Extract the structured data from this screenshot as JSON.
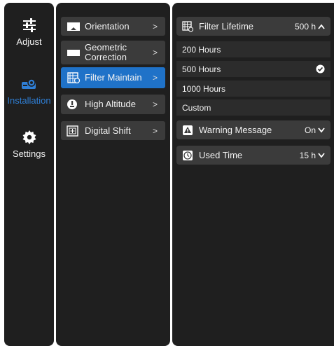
{
  "sidebar": {
    "items": [
      {
        "label": "Adjust",
        "icon": "sliders-icon"
      },
      {
        "label": "Installation",
        "icon": "projector-icon",
        "active": true
      },
      {
        "label": "Settings",
        "icon": "gear-icon"
      }
    ]
  },
  "submenu": {
    "items": [
      {
        "label": "Orientation",
        "icon": "orientation-icon"
      },
      {
        "label_line1": "Geometric",
        "label_line2": "Correction",
        "icon": "geometric-icon"
      },
      {
        "label": "Filter Maintain",
        "icon": "filter-icon",
        "active": true
      },
      {
        "label": "High Altitude",
        "icon": "altitude-icon"
      },
      {
        "label": "Digital Shift",
        "icon": "shift-icon"
      }
    ],
    "chevron": ">"
  },
  "detail": {
    "filter_lifetime": {
      "label": "Filter Lifetime",
      "value": "500 h",
      "expanded": true
    },
    "options": [
      {
        "label": "200 Hours",
        "selected": false
      },
      {
        "label": "500 Hours",
        "selected": true
      },
      {
        "label": "1000 Hours",
        "selected": false
      },
      {
        "label": "Custom",
        "selected": false
      }
    ],
    "warning_message": {
      "label": "Warning Message",
      "value": "On"
    },
    "used_time": {
      "label": "Used Time",
      "value": "15 h"
    }
  },
  "colors": {
    "accent": "#1f72c8",
    "panel": "#1f1f1f",
    "item": "#3b3b3b"
  }
}
